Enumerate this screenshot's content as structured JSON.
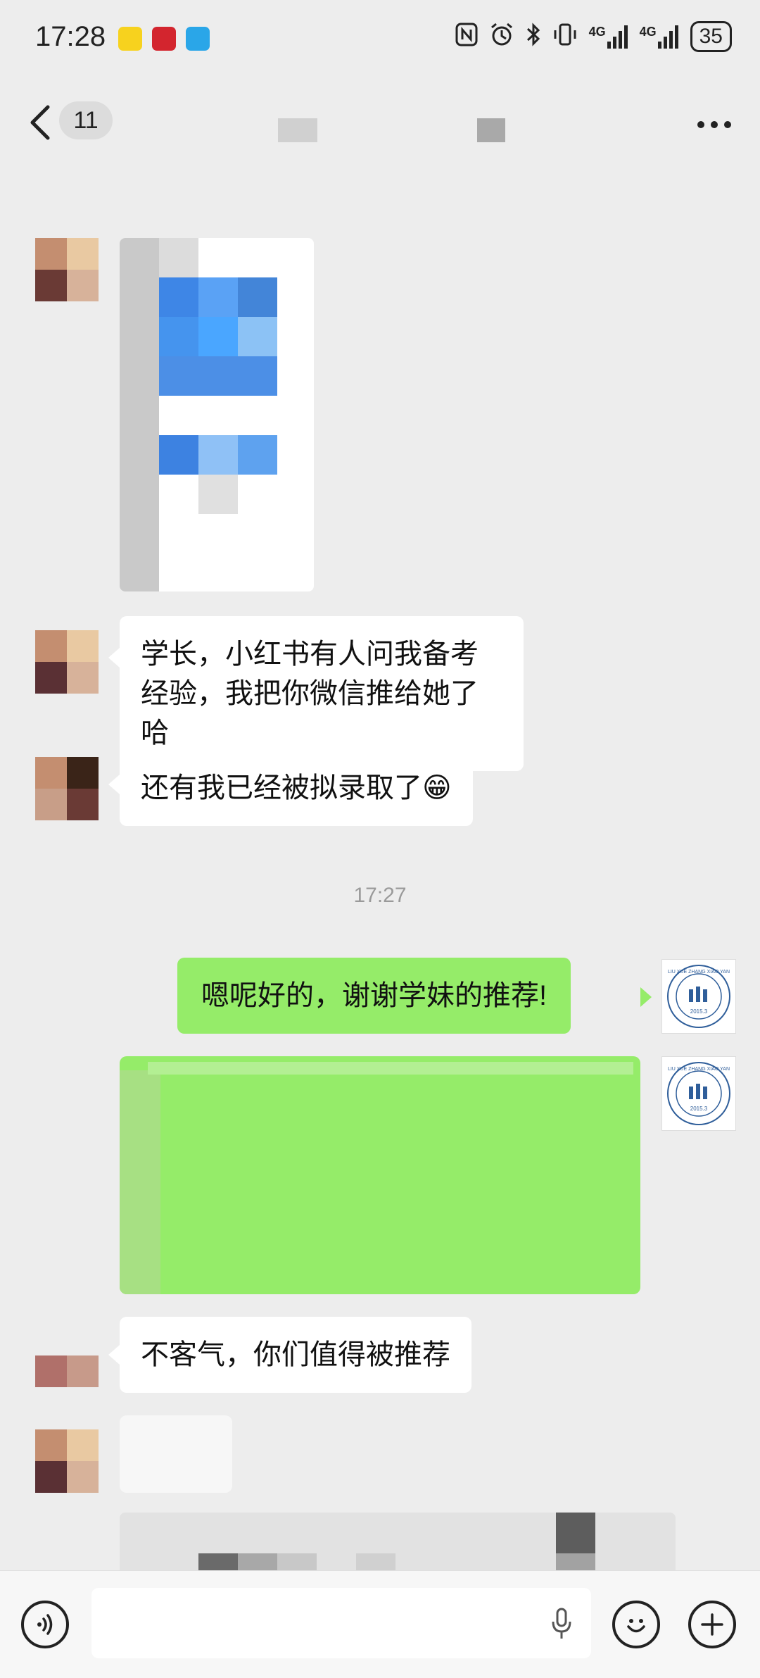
{
  "status_bar": {
    "time": "17:28",
    "battery": "35",
    "net1": "4G",
    "net2": "4G",
    "icons": [
      "nfc-icon",
      "alarm-icon",
      "bluetooth-icon",
      "vibrate-icon",
      "signal-4g-icon",
      "signal-4g-icon-2",
      "battery-icon"
    ]
  },
  "header": {
    "unread_count": "11"
  },
  "messages": {
    "m1": "学长，小红书有人问我备考经验，我把你微信推给她了哈",
    "m2": "还有我已经被拟录取了",
    "m2_emoji": "😁",
    "timestamp": "17:27",
    "m3": "嗯呢好的，谢谢学妹的推荐!",
    "m4": "不客气，你们值得被推荐"
  },
  "my_avatar": {
    "ring_text": "LIU XUE ZHANG XIAO YAN",
    "year": "2015.3"
  },
  "colors": {
    "background": "#ededed",
    "bubble_out": "#95ec69",
    "bubble_in": "#ffffff",
    "timestamp": "#9a9a9a"
  }
}
